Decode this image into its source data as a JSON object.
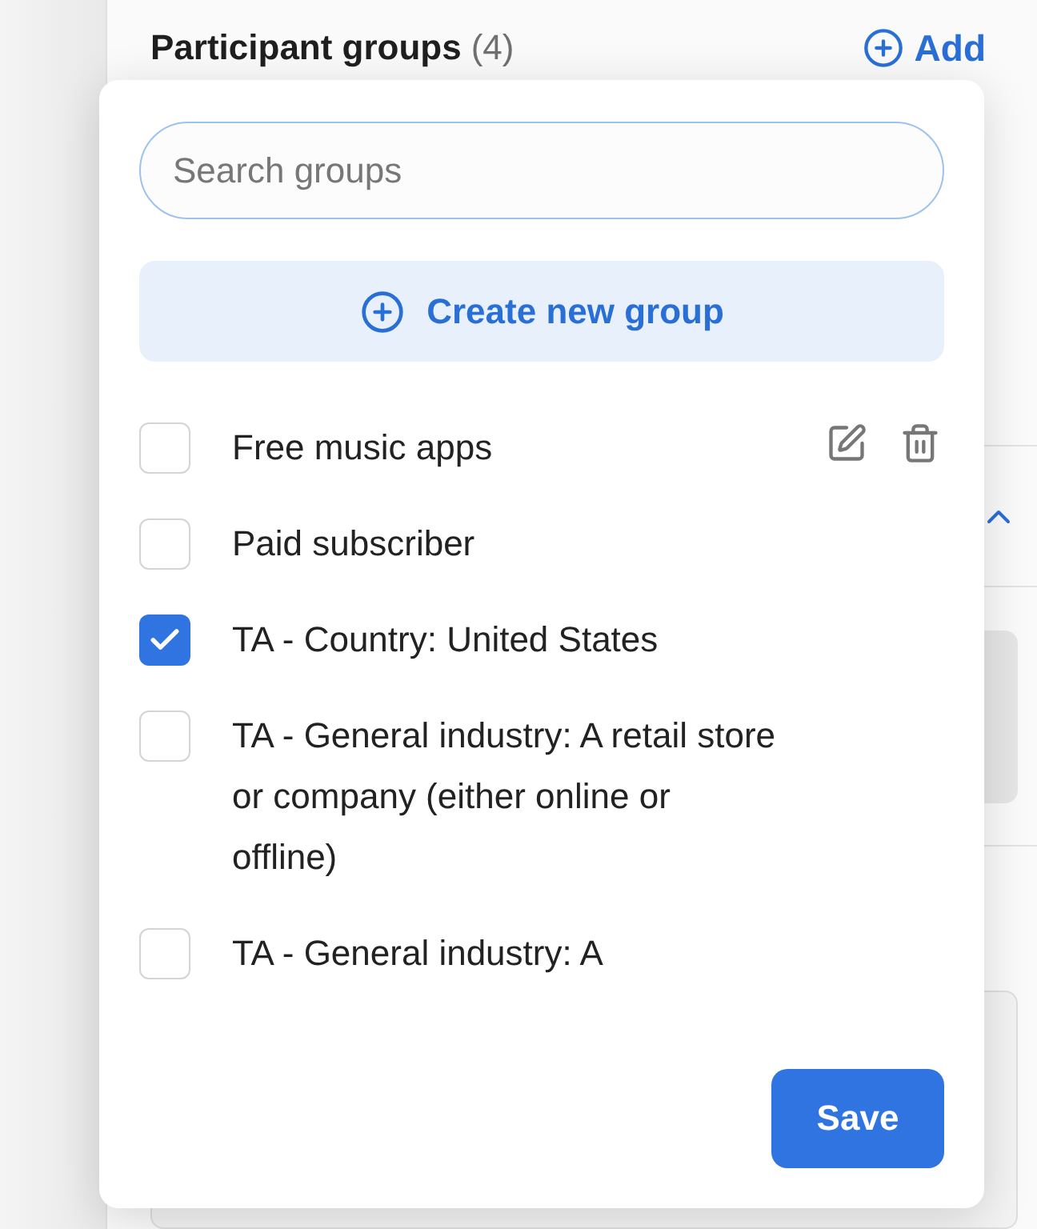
{
  "panel": {
    "title": "Participant groups",
    "count": "(4)",
    "add_label": "Add"
  },
  "popup": {
    "search": {
      "placeholder": "Search groups"
    },
    "create_label": "Create new group",
    "groups": [
      {
        "label": "Free music apps",
        "checked": false,
        "actions": true
      },
      {
        "label": "Paid subscriber",
        "checked": false,
        "actions": false
      },
      {
        "label": "TA - Country: United States",
        "checked": true,
        "actions": false
      },
      {
        "label": "TA - General industry: A retail store or company (either online or offline)",
        "checked": false,
        "actions": false
      },
      {
        "label": "TA - General industry: A",
        "checked": false,
        "actions": false
      }
    ],
    "save_label": "Save"
  }
}
